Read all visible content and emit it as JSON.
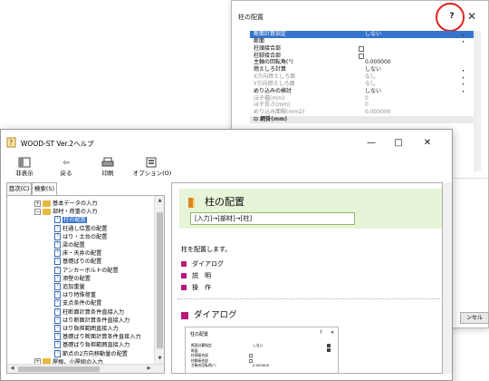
{
  "dialog": {
    "title": "柱の配置",
    "help_label": "?",
    "close_label": "✕",
    "button_partial": "ンセル",
    "properties": [
      {
        "label": "断面計算指定",
        "value": "しない",
        "state": "selected",
        "dropdown": true
      },
      {
        "label": "断面",
        "value": "",
        "state": "normal",
        "dropdown": true
      },
      {
        "label": "柱頭接合部",
        "value": "",
        "state": "normal",
        "checkbox": true
      },
      {
        "label": "柱脚接合部",
        "value": "",
        "state": "normal",
        "checkbox": true
      },
      {
        "label": "主軸の回転角(°)",
        "value": "0.000000",
        "state": "normal"
      },
      {
        "label": "燃えしろ計算",
        "value": "しない",
        "state": "normal",
        "dropdown": true
      },
      {
        "label": "X方向燃えしろ面",
        "value": "なし",
        "state": "disabled",
        "dropdown": true
      },
      {
        "label": "Y方向燃えしろ面",
        "value": "なし",
        "state": "disabled",
        "dropdown": true
      },
      {
        "label": "めり込みの検討",
        "value": "しない",
        "state": "normal",
        "dropdown": true
      },
      {
        "label": "ほぞ幅(mm)",
        "value": "0",
        "state": "disabled"
      },
      {
        "label": "ほぞ長さ(mm)",
        "value": "0",
        "state": "disabled"
      },
      {
        "label": "めり込み面積(mm2)",
        "value": "0.000000",
        "state": "disabled"
      },
      {
        "label": "⊟ 網掛(mm)",
        "value": "",
        "state": "group"
      }
    ]
  },
  "help_window": {
    "title": "WOOD-ST Ver.2ヘルプ",
    "window_buttons": {
      "minimize": "—",
      "maximize": "□",
      "close": "✕"
    },
    "toolbar": [
      {
        "name": "hide",
        "label": "非表示"
      },
      {
        "name": "back",
        "label": "戻る"
      },
      {
        "name": "print",
        "label": "印刷"
      },
      {
        "name": "options",
        "label": "オプション(O)"
      }
    ],
    "tabs": [
      {
        "name": "contents",
        "label": "目次(C)"
      },
      {
        "name": "search",
        "label": "検索(S)"
      }
    ],
    "tree": [
      {
        "label": "基本データの入力",
        "type": "folder",
        "expand": "+",
        "level": 0
      },
      {
        "label": "部材・荷重の入力",
        "type": "folder",
        "expand": "−",
        "level": 0
      },
      {
        "label": "柱の配置",
        "type": "page",
        "level": 1,
        "selected": true
      },
      {
        "label": "柱通し位置の配置",
        "type": "page",
        "level": 1
      },
      {
        "label": "はり・土台の配置",
        "type": "page",
        "level": 1
      },
      {
        "label": "梁の配置",
        "type": "page",
        "level": 1
      },
      {
        "label": "床・天井の配置",
        "type": "page",
        "level": 1
      },
      {
        "label": "基礎ばりの配置",
        "type": "page",
        "level": 1
      },
      {
        "label": "アンカーボルトの配置",
        "type": "page",
        "level": 1
      },
      {
        "label": "添壁の配置",
        "type": "page",
        "level": 1
      },
      {
        "label": "追加重量",
        "type": "page",
        "level": 1
      },
      {
        "label": "はり特殊荷重",
        "type": "page",
        "level": 1
      },
      {
        "label": "支点条件の配置",
        "type": "page",
        "level": 1
      },
      {
        "label": "柱断面計算条件直接入力",
        "type": "page",
        "level": 1
      },
      {
        "label": "はり断面計算条件直接入力",
        "type": "page",
        "level": 1
      },
      {
        "label": "はり負担範囲直接入力",
        "type": "page",
        "level": 1
      },
      {
        "label": "基礎ばり断面計算条件直接入力",
        "type": "page",
        "level": 1
      },
      {
        "label": "基礎ばり負担範囲直接入力",
        "type": "page",
        "level": 1
      },
      {
        "label": "節点の2方向移動量の配置",
        "type": "page",
        "level": 1
      },
      {
        "label": "屋根、小屋組の入力",
        "type": "folder",
        "expand": "+",
        "level": 0
      }
    ],
    "content": {
      "title": "柱の配置",
      "path": "[入力]→[部材]→[柱]",
      "intro": "柱を配置します。",
      "bullets": [
        "ダイアログ",
        "説　明",
        "操　作"
      ],
      "section_heading": "ダイアログ",
      "mini_dialog": {
        "title": "柱の配置",
        "help": "?",
        "close": "✕",
        "rows": [
          {
            "label": "断面計算指定",
            "value": "しない",
            "dropdown": true
          },
          {
            "label": "断面",
            "value": "",
            "dropdown": true
          },
          {
            "label": "柱頭接合部",
            "value": "",
            "checkbox": true
          },
          {
            "label": "柱脚接合部",
            "value": "",
            "checkbox": true
          },
          {
            "label": "主軸の回転角(°)",
            "value": "0.000000"
          }
        ]
      }
    }
  }
}
